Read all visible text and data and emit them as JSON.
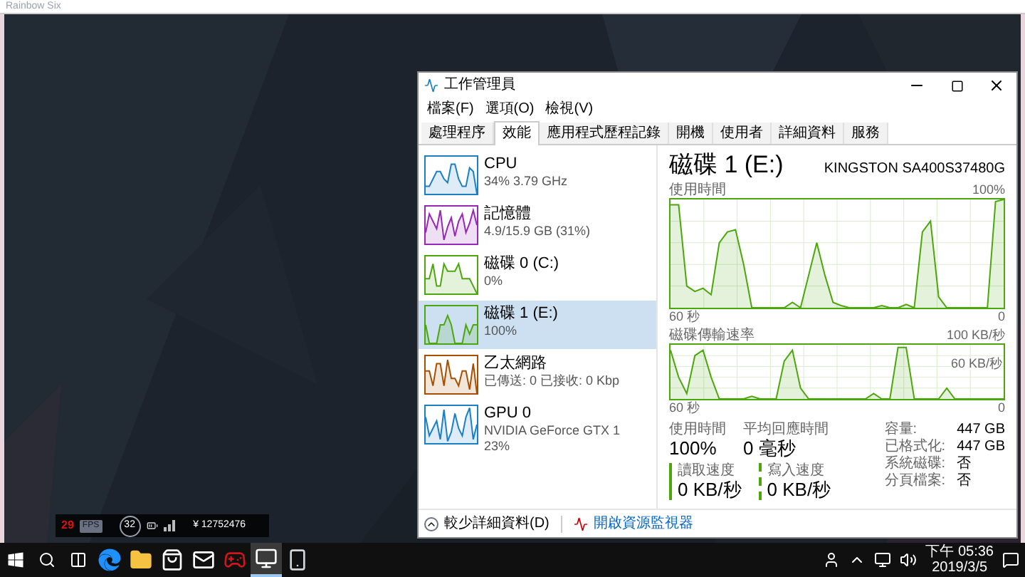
{
  "game_window": {
    "title": "Rainbow Six"
  },
  "hud": {
    "fps": "29",
    "fps_label": "FPS",
    "ping": "32",
    "score": "¥ 12752476"
  },
  "task_manager": {
    "title": "工作管理員",
    "menu": [
      "檔案(F)",
      "選項(O)",
      "檢視(V)"
    ],
    "tabs": [
      {
        "label": "處理程序",
        "selected": false
      },
      {
        "label": "效能",
        "selected": true
      },
      {
        "label": "應用程式歷程記錄",
        "selected": false
      },
      {
        "label": "開機",
        "selected": false
      },
      {
        "label": "使用者",
        "selected": false
      },
      {
        "label": "詳細資料",
        "selected": false
      },
      {
        "label": "服務",
        "selected": false
      }
    ],
    "resources": [
      {
        "name": "CPU",
        "details": [
          "34% 3.79 GHz"
        ],
        "color": "#1b7fc4",
        "selected": false
      },
      {
        "name": "記憶體",
        "details": [
          "4.9/15.9 GB (31%)"
        ],
        "color": "#9528b4",
        "selected": false
      },
      {
        "name": "磁碟 0 (C:)",
        "details": [
          "0%"
        ],
        "color": "#4da60c",
        "selected": false
      },
      {
        "name": "磁碟 1 (E:)",
        "details": [
          "100%"
        ],
        "color": "#4da60c",
        "selected": true
      },
      {
        "name": "乙太網路",
        "details": [
          "已傳送: 0 已接收: 0 Kbp"
        ],
        "color": "#a74f01",
        "selected": false
      },
      {
        "name": "GPU 0",
        "details": [
          "NVIDIA GeForce GTX 1",
          "23%"
        ],
        "color": "#1b7fc4",
        "selected": false
      }
    ],
    "disk": {
      "title": "磁碟 1 (E:)",
      "model": "KINGSTON SA400S37480G",
      "usage_chart": {
        "label": "使用時間",
        "max": "100%",
        "time": "60 秒",
        "min": "0"
      },
      "rate_chart": {
        "label": "磁碟傳輸速率",
        "max": "100 KB/秒",
        "mid": "60 KB/秒",
        "time": "60 秒",
        "min": "0"
      },
      "stats": [
        {
          "label": "使用時間",
          "value": "100%"
        },
        {
          "label": "平均回應時間",
          "value": "0 毫秒"
        }
      ],
      "rates": [
        {
          "kind": "read",
          "label": "讀取速度",
          "value": "0 KB/秒"
        },
        {
          "kind": "write",
          "label": "寫入速度",
          "value": "0 KB/秒"
        }
      ],
      "properties": [
        {
          "label": "容量:",
          "value": "447 GB"
        },
        {
          "label": "已格式化:",
          "value": "447 GB"
        },
        {
          "label": "系統磁碟:",
          "value": "否"
        },
        {
          "label": "分頁檔案:",
          "value": "否"
        }
      ]
    },
    "footer": {
      "fewer_details": "較少詳細資料(D)",
      "resource_monitor": "開啟資源監視器"
    }
  },
  "taskbar": {
    "apps": [
      {
        "kind": "edge",
        "selected": false
      },
      {
        "kind": "explorer",
        "selected": false
      },
      {
        "kind": "store",
        "selected": false
      },
      {
        "kind": "mail",
        "selected": false
      },
      {
        "kind": "game",
        "selected": false
      },
      {
        "kind": "monitor",
        "selected": true
      },
      {
        "kind": "app",
        "selected": false
      }
    ],
    "time": "下午 05:36",
    "date": "2019/3/5"
  }
}
